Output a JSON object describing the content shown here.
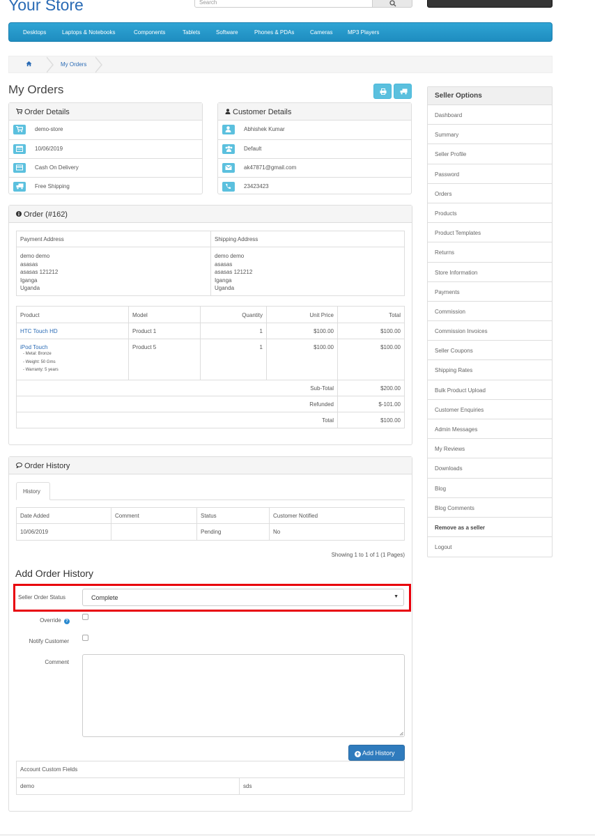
{
  "header": {
    "store_title": "Your Store",
    "search_placeholder": "Search"
  },
  "menu": [
    "Desktops",
    "Laptops & Notebooks",
    "Components",
    "Tablets",
    "Software",
    "Phones & PDAs",
    "Cameras",
    "MP3 Players"
  ],
  "breadcrumb": {
    "current": "My Orders"
  },
  "page_title": "My Orders",
  "order_details": {
    "heading": "Order Details",
    "rows": [
      {
        "icon": "cart-icon",
        "text": "demo-store",
        "link": true
      },
      {
        "icon": "calendar-icon",
        "text": "10/06/2019",
        "link": false
      },
      {
        "icon": "credit-card-icon",
        "text": "Cash On Delivery",
        "link": false
      },
      {
        "icon": "truck-icon",
        "text": "Free Shipping",
        "link": false
      }
    ]
  },
  "customer_details": {
    "heading": "Customer Details",
    "rows": [
      {
        "icon": "user-icon",
        "text": "Abhishek Kumar",
        "link": false
      },
      {
        "icon": "group-icon",
        "text": "Default",
        "link": false
      },
      {
        "icon": "envelope-icon",
        "text": "ak47871@gmail.com",
        "link": true
      },
      {
        "icon": "phone-icon",
        "text": "23423423",
        "link": false
      }
    ]
  },
  "order": {
    "heading": "Order (#162)",
    "payment_address_label": "Payment Address",
    "shipping_address_label": "Shipping Address",
    "payment_address": [
      "demo demo",
      "asasas",
      "asasas 121212",
      "Iganga",
      "Uganda"
    ],
    "shipping_address": [
      "demo demo",
      "asasas",
      "asasas 121212",
      "Iganga",
      "Uganda"
    ],
    "columns": [
      "Product",
      "Model",
      "Quantity",
      "Unit Price",
      "Total"
    ],
    "products": [
      {
        "name": "HTC Touch HD",
        "options": [],
        "model": "Product 1",
        "qty": "1",
        "price": "$100.00",
        "total": "$100.00"
      },
      {
        "name": "iPod Touch",
        "options": [
          "- Metal: Bronze",
          "- Weight: 50 Gms",
          "- Warranty: 5 years"
        ],
        "model": "Product 5",
        "qty": "1",
        "price": "$100.00",
        "total": "$100.00"
      }
    ],
    "totals": [
      {
        "label": "Sub-Total",
        "value": "$200.00"
      },
      {
        "label": "Refunded",
        "value": "$-101.00"
      },
      {
        "label": "Total",
        "value": "$100.00"
      }
    ]
  },
  "history": {
    "heading": "Order History",
    "tab": "History",
    "columns": [
      "Date Added",
      "Comment",
      "Status",
      "Customer Notified"
    ],
    "rows": [
      {
        "date": "10/06/2019",
        "comment": "",
        "status": "Pending",
        "notified": "No"
      }
    ],
    "pagination": "Showing 1 to 1 of 1 (1 Pages)"
  },
  "add_history": {
    "heading": "Add Order History",
    "status_label": "Seller Order Status",
    "status_value": "Complete",
    "override_label": "Override",
    "notify_label": "Notify Customer",
    "comment_label": "Comment",
    "button": "Add History"
  },
  "custom_fields": {
    "heading": "Account Custom Fields",
    "rows": [
      {
        "name": "demo",
        "value": "sds"
      }
    ]
  },
  "seller_options": {
    "heading": "Seller Options",
    "items": [
      "Dashboard",
      "Summary",
      "Seller Profile",
      "Password",
      "Orders",
      "Products",
      "Product Templates",
      "Returns",
      "Store Information",
      "Payments",
      "Commission",
      "Commission Invoices",
      "Seller Coupons",
      "Shipping Rates",
      "Bulk Product Upload",
      "Customer Enquiries",
      "Admin Messages",
      "My Reviews",
      "Downloads",
      "Blog",
      "Blog Comments",
      "Remove as a seller",
      "Logout"
    ],
    "bold_item": "Remove as a seller"
  },
  "colors": {
    "accent": "#2a6bb5",
    "info": "#5bc0de",
    "menu": "#229ac8",
    "highlight": "#e8000b",
    "primary_button": "#2f7bbd"
  }
}
